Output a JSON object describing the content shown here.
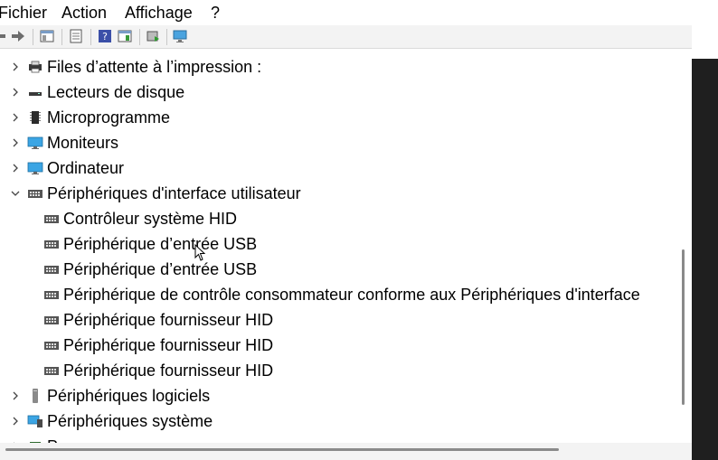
{
  "menu": {
    "items": [
      "Fichier",
      "Action",
      "Affichage",
      "?"
    ]
  },
  "toolbar": {
    "buttons": [
      "back-arrow-icon",
      "forward-arrow-icon",
      "console-tree-icon",
      "properties-icon",
      "help-icon",
      "action-pane-icon",
      "update-driver-icon",
      "monitor-scan-icon"
    ]
  },
  "tree": {
    "items": [
      {
        "label": "Files d’attente à l’impression :",
        "icon": "printer-icon",
        "level": 0,
        "expander": "collapsed"
      },
      {
        "label": "Lecteurs de disque",
        "icon": "disk-drive-icon",
        "level": 0,
        "expander": "collapsed"
      },
      {
        "label": "Microprogramme",
        "icon": "firmware-chip-icon",
        "level": 0,
        "expander": "collapsed"
      },
      {
        "label": "Moniteurs",
        "icon": "monitor-icon",
        "level": 0,
        "expander": "collapsed"
      },
      {
        "label": "Ordinateur",
        "icon": "computer-icon",
        "level": 0,
        "expander": "collapsed"
      },
      {
        "label": "Périphériques d'interface utilisateur",
        "icon": "hid-icon",
        "level": 0,
        "expander": "expanded"
      },
      {
        "label": "Contrôleur système HID",
        "icon": "hid-icon",
        "level": 1
      },
      {
        "label": "Périphérique d’entrée USB",
        "icon": "hid-icon",
        "level": 1
      },
      {
        "label": "Périphérique d’entrée USB",
        "icon": "hid-icon",
        "level": 1
      },
      {
        "label": "Périphérique de contrôle consommateur conforme aux Périphériques d'interface",
        "icon": "hid-icon",
        "level": 1
      },
      {
        "label": "Périphérique fournisseur HID",
        "icon": "hid-icon",
        "level": 1
      },
      {
        "label": "Périphérique fournisseur HID",
        "icon": "hid-icon",
        "level": 1
      },
      {
        "label": "Périphérique fournisseur HID",
        "icon": "hid-icon",
        "level": 1
      },
      {
        "label": "Périphériques logiciels",
        "icon": "software-device-icon",
        "level": 0,
        "expander": "collapsed"
      },
      {
        "label": "Périphériques système",
        "icon": "system-device-icon",
        "level": 0,
        "expander": "collapsed"
      },
      {
        "label": "P",
        "icon": "processor-icon",
        "level": 0,
        "expander": "collapsed"
      }
    ]
  },
  "colors": {
    "window_bg": "#ffffff",
    "toolbar_bg": "#f3f3f3",
    "outer_dark": "#1f1f1f",
    "scroll_thumb": "#8a8a8a"
  }
}
